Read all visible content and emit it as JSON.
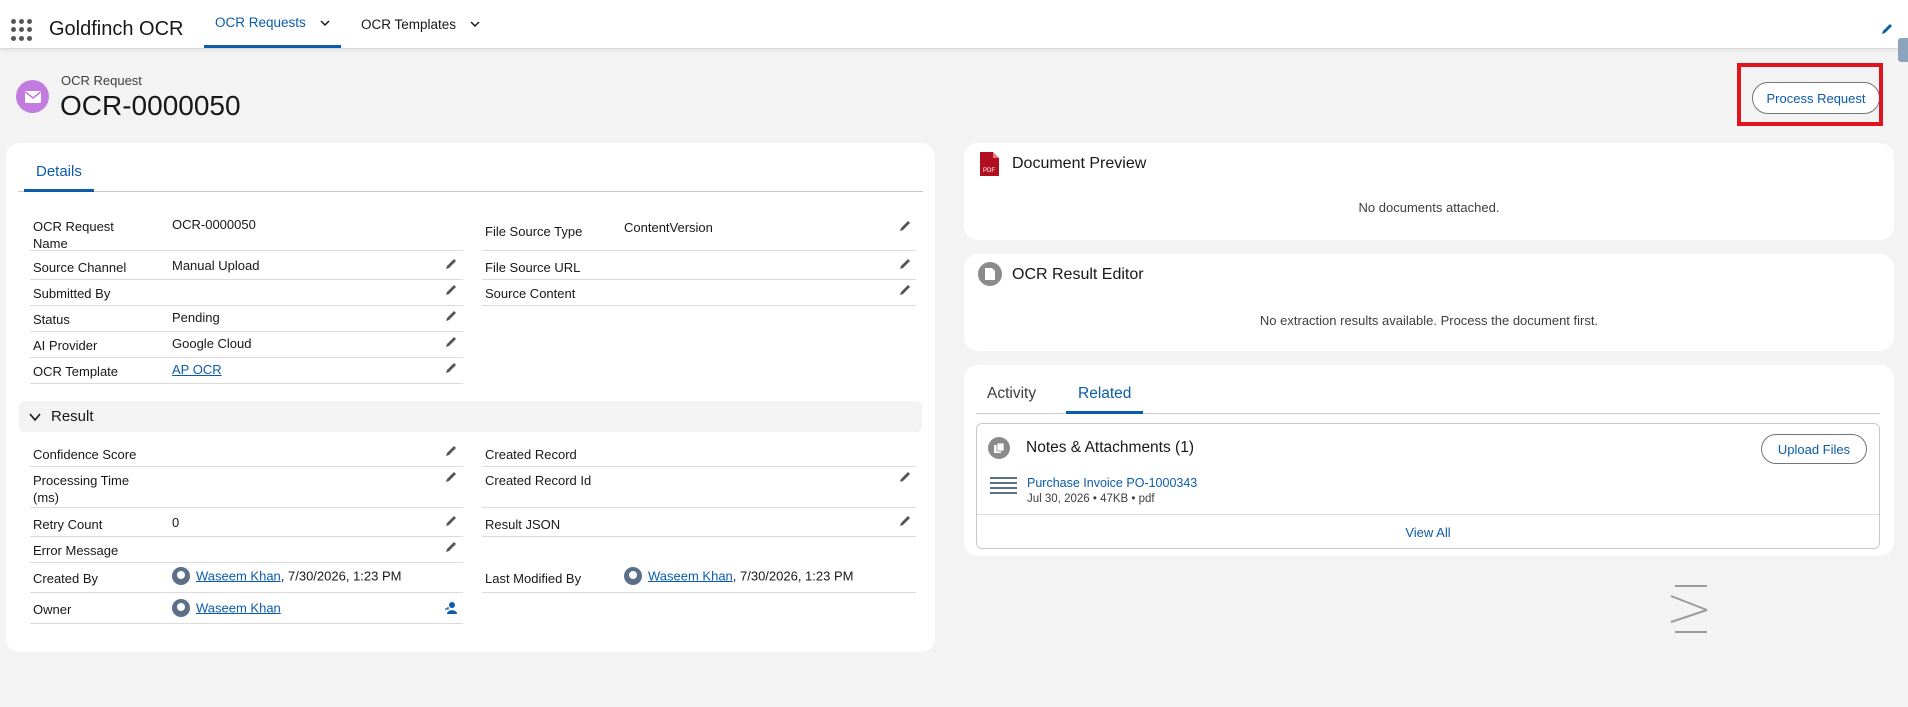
{
  "nav": {
    "app_name": "Goldfinch OCR",
    "tabs": [
      {
        "label": "OCR Requests"
      },
      {
        "label": "OCR Templates"
      }
    ]
  },
  "header": {
    "record_type": "OCR Request",
    "record_name": "OCR-0000050",
    "process_button": "Process Request"
  },
  "details": {
    "tab_label": "Details",
    "left_fields": [
      {
        "label": "OCR Request Name",
        "value": "OCR-0000050"
      },
      {
        "label": "Source Channel",
        "value": "Manual Upload"
      },
      {
        "label": "Submitted By",
        "value": ""
      },
      {
        "label": "Status",
        "value": "Pending"
      },
      {
        "label": "AI Provider",
        "value": "Google Cloud"
      },
      {
        "label": "OCR Template",
        "value": "AP OCR"
      }
    ],
    "right_fields": [
      {
        "label": "File Source Type",
        "value": "ContentVersion"
      },
      {
        "label": "File Source URL",
        "value": ""
      },
      {
        "label": "Source Content",
        "value": ""
      }
    ],
    "result_section": {
      "title": "Result",
      "left_fields": [
        {
          "label": "Confidence Score",
          "value": ""
        },
        {
          "label": "Processing Time (ms)",
          "value": ""
        },
        {
          "label": "Retry Count",
          "value": "0"
        },
        {
          "label": "Error Message",
          "value": ""
        },
        {
          "label": "Created By",
          "user": "Waseem Khan",
          "date": ", 7/30/2026, 1:23 PM"
        },
        {
          "label": "Owner",
          "user": "Waseem Khan"
        }
      ],
      "right_fields": [
        {
          "label": "Created Record",
          "value": ""
        },
        {
          "label": "Created Record Id",
          "value": ""
        },
        {
          "label": "Result JSON",
          "value": ""
        },
        {
          "label": "Last Modified By",
          "user": "Waseem Khan",
          "date": ", 7/30/2026, 1:23 PM"
        }
      ]
    }
  },
  "document_preview": {
    "title": "Document Preview",
    "empty": "No documents attached.",
    "icon_text": "PDF"
  },
  "ocr_result_editor": {
    "title": "OCR Result Editor",
    "empty": "No extraction results available. Process the document first."
  },
  "related": {
    "tabs": [
      "Activity",
      "Related"
    ],
    "notes": {
      "title": "Notes & Attachments (1)",
      "upload_label": "Upload Files",
      "file_name": "Purchase Invoice PO-1000343",
      "file_meta": "Jul 30, 2026 • 47KB • pdf",
      "view_all": "View All"
    }
  },
  "colors": {
    "brand": "#0b5cab",
    "record_icon": "#c27ce0",
    "highlight": "#e0141e"
  }
}
